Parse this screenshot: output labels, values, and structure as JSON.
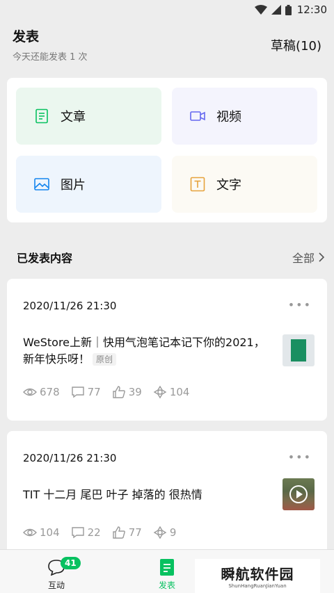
{
  "status": {
    "time": "12:30"
  },
  "header": {
    "title": "发表",
    "subtitle": "今天还能发表 1 次",
    "drafts": "草稿(10)"
  },
  "publish_tiles": [
    {
      "label": "文章",
      "icon": "article-icon",
      "color": "#07c160"
    },
    {
      "label": "视频",
      "icon": "video-icon",
      "color": "#6467f0"
    },
    {
      "label": "图片",
      "icon": "image-icon",
      "color": "#1485ee"
    },
    {
      "label": "文字",
      "icon": "text-icon",
      "color": "#e6a23c"
    }
  ],
  "published": {
    "heading": "已发表内容",
    "view_all": "全部"
  },
  "posts": [
    {
      "date": "2020/11/26 21:30",
      "title": "WeStore上新｜快用气泡笔记本记下你的2021，新年快乐呀！",
      "tag": "原创",
      "stats": {
        "views": "678",
        "comments": "77",
        "likes": "39",
        "shares": "104"
      }
    },
    {
      "date": "2020/11/26 21:30",
      "title": "TIT 十二月 尾巴 叶子 掉落的 很热情",
      "stats": {
        "views": "104",
        "comments": "22",
        "likes": "77",
        "shares": "9"
      }
    }
  ],
  "tabbar": {
    "interact_label": "互动",
    "interact_badge": "41",
    "publish_label": "发表"
  },
  "watermark": {
    "text": "瞬航软件园",
    "sub": "ShunHangRuanJianYuan"
  }
}
